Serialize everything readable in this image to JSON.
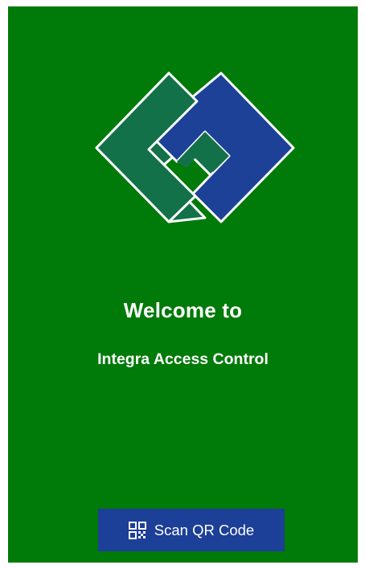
{
  "screen": {
    "background_color": "#007a08",
    "logo_icon": "integra-logo-icon",
    "welcome_text": "Welcome to",
    "app_name": "Integra Access Control"
  },
  "scan_button": {
    "label": "Scan QR Code",
    "icon": "qr-code-icon",
    "background_color": "#1c3f97"
  },
  "colors": {
    "logo_green": "#13714a",
    "logo_blue": "#1c4197",
    "logo_outline": "#ffffff"
  }
}
